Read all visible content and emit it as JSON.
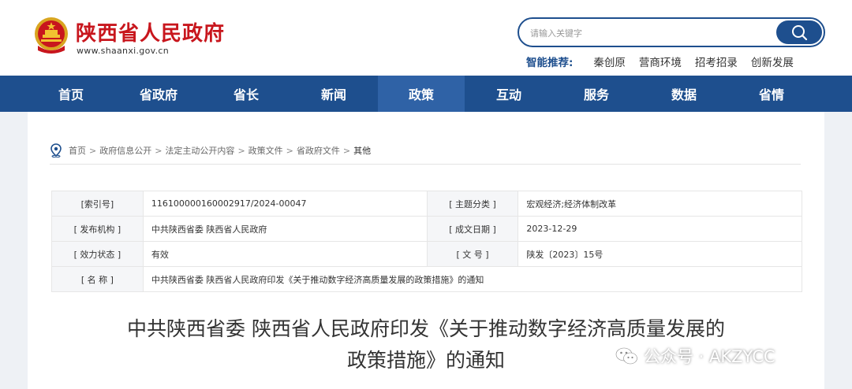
{
  "header": {
    "site_title": "陕西省人民政府",
    "site_url": "www.shaanxi.gov.cn",
    "emblem_icon": "national-emblem-icon",
    "brand_color": "#c8161d"
  },
  "search": {
    "placeholder": "请输入关键字"
  },
  "smart_recommend": {
    "label": "智能推荐:",
    "links": [
      "秦创原",
      "营商环境",
      "招考招录",
      "创新发展"
    ]
  },
  "nav": {
    "items": [
      "首页",
      "省政府",
      "省长",
      "新闻",
      "政策",
      "互动",
      "服务",
      "数据",
      "省情"
    ],
    "active": "政策",
    "bar_color": "#1e4f8e"
  },
  "breadcrumb": {
    "items": [
      "首页",
      "政府信息公开",
      "法定主动公开内容",
      "政策文件",
      "省政府文件"
    ],
    "separator": ">",
    "current": "其他"
  },
  "info": {
    "index_label": "[索引号]",
    "index_value": "116100000160002917/2024-00047",
    "topic_label": "[ 主题分类 ]",
    "topic_value": "宏观经济;经济体制改革",
    "publisher_label": "[ 发布机构 ]",
    "publisher_value": "中共陕西省委 陕西省人民政府",
    "date_label": "[ 成文日期 ]",
    "date_value": "2023-12-29",
    "status_label": "[ 效力状态 ]",
    "status_value": "有效",
    "docno_label": "[ 文 号 ]",
    "docno_value": "陕发〔2023〕15号",
    "name_label": "[ 名 称 ]",
    "name_value": "中共陕西省委 陕西省人民政府印发《关于推动数字经济高质量发展的政策措施》的通知"
  },
  "document": {
    "title_line1": "中共陕西省委 陕西省人民政府印发《关于推动数字经济高质量发展的",
    "title_line2": "政策措施》的通知"
  },
  "watermark": {
    "text": "公众号 · AKZYCC"
  }
}
